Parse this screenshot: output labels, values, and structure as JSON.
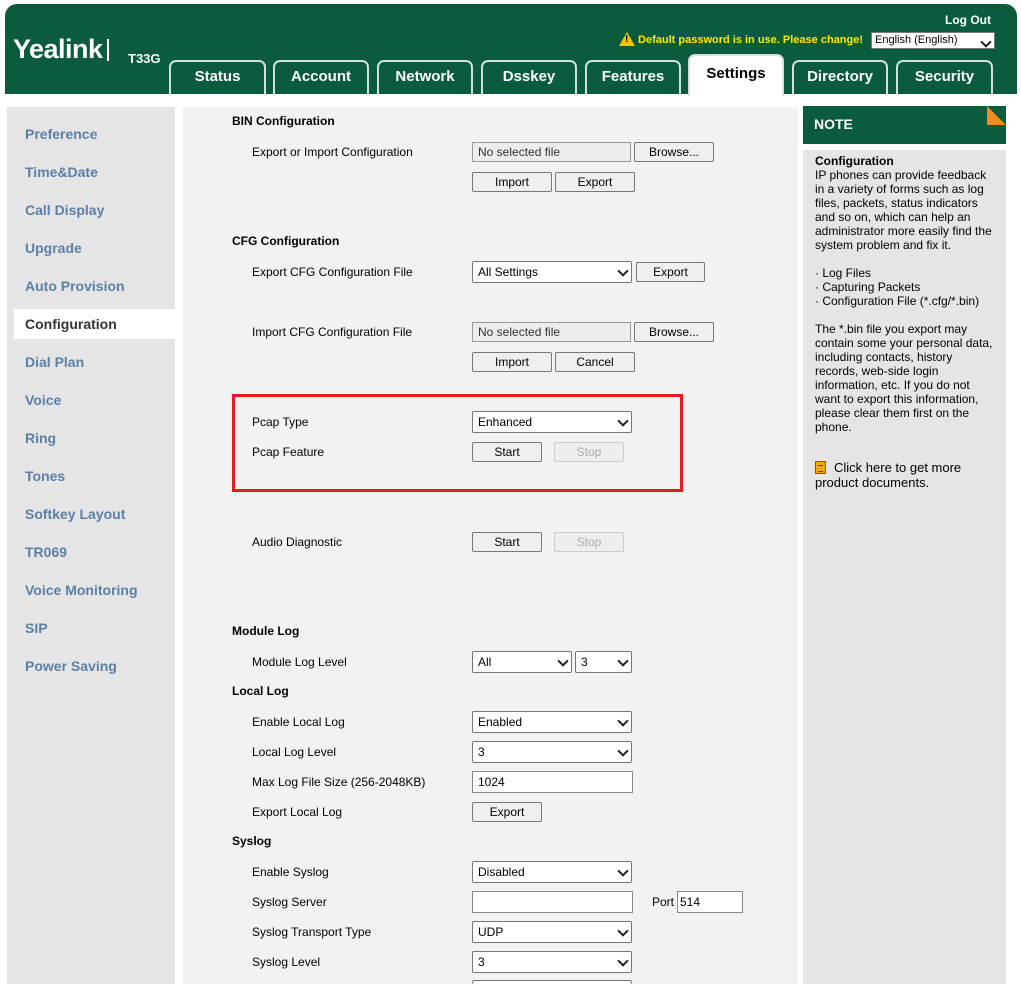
{
  "header": {
    "logo": "Yealink",
    "model": "T33G",
    "logout": "Log Out",
    "warning": "Default password is in use. Please change!",
    "language": "English (English)"
  },
  "tabs": [
    "Status",
    "Account",
    "Network",
    "Dsskey",
    "Features",
    "Settings",
    "Directory",
    "Security"
  ],
  "active_tab": "Settings",
  "sidebar": {
    "items": [
      "Preference",
      "Time&Date",
      "Call Display",
      "Upgrade",
      "Auto Provision",
      "Configuration",
      "Dial Plan",
      "Voice",
      "Ring",
      "Tones",
      "Softkey Layout",
      "TR069",
      "Voice Monitoring",
      "SIP",
      "Power Saving"
    ],
    "active": "Configuration"
  },
  "main": {
    "bin": {
      "title": "BIN Configuration",
      "label": "Export or Import Configuration",
      "file": "No selected file",
      "browse": "Browse...",
      "import": "Import",
      "export": "Export"
    },
    "cfg": {
      "title": "CFG Configuration",
      "export_label": "Export CFG Configuration File",
      "export_select": "All Settings",
      "export_btn": "Export",
      "import_label": "Import CFG Configuration File",
      "file": "No selected file",
      "browse": "Browse...",
      "import": "Import",
      "cancel": "Cancel"
    },
    "pcap": {
      "type_label": "Pcap Type",
      "type_value": "Enhanced",
      "feature_label": "Pcap Feature",
      "start": "Start",
      "stop": "Stop"
    },
    "audio": {
      "label": "Audio Diagnostic",
      "start": "Start",
      "stop": "Stop"
    },
    "module_log": {
      "title": "Module Log",
      "level_label": "Module Log Level",
      "module": "All",
      "level": "3"
    },
    "local_log": {
      "title": "Local Log",
      "enable_label": "Enable Local Log",
      "enable_value": "Enabled",
      "level_label": "Local Log Level",
      "level_value": "3",
      "size_label": "Max Log File Size (256-2048KB)",
      "size_value": "1024",
      "export_label": "Export Local Log",
      "export_btn": "Export"
    },
    "syslog": {
      "title": "Syslog",
      "enable_label": "Enable Syslog",
      "enable_value": "Disabled",
      "server_label": "Syslog Server",
      "server_value": "",
      "port_label": "Port",
      "port_value": "514",
      "transport_label": "Syslog Transport Type",
      "transport_value": "UDP",
      "level_label": "Syslog Level",
      "level_value": "3"
    }
  },
  "note": {
    "header": "NOTE",
    "title": "Configuration",
    "intro": "IP phones can provide feedback in a variety of forms such as log files, packets, status indicators and so on, which can help an administrator more easily find the system problem and fix it.",
    "items": [
      "· Log Files",
      "· Capturing Packets",
      "· Configuration File (*.cfg/*.bin)"
    ],
    "warning": "The *.bin file you export may contain some your personal data, including contacts, history records, web-side login information, etc. If you do not want to export this information, please clear them first on the phone.",
    "link": "Click here to get more product documents."
  },
  "colors": {
    "brand_green": "#0a5c3d",
    "warning_yellow": "#ffe600",
    "highlight_red": "#e01b24",
    "sidebar_link": "#5b7fa6",
    "note_corner": "#f08a1d"
  }
}
